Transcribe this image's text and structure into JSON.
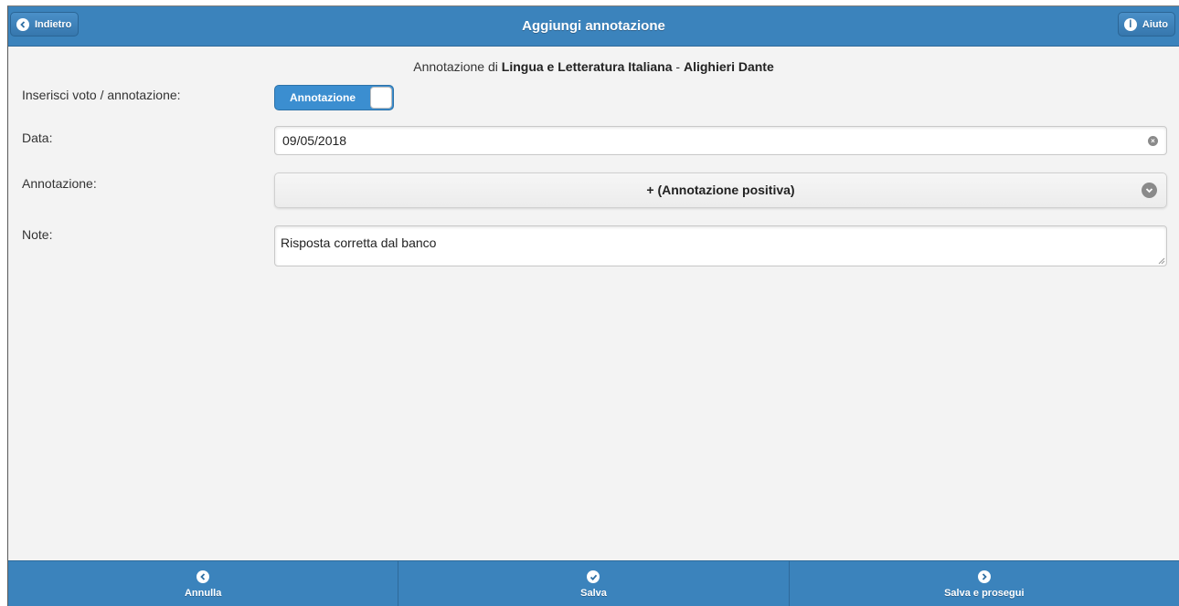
{
  "header": {
    "title": "Aggiungi annotazione",
    "back_label": "Indietro",
    "help_label": "Aiuto"
  },
  "subtitle": {
    "prefix": "Annotazione di ",
    "subject": "Lingua e Letteratura Italiana",
    "separator": " - ",
    "student": "Alighieri Dante"
  },
  "form": {
    "type_label": "Inserisci voto / annotazione:",
    "type_toggle_value": "Annotazione",
    "date_label": "Data:",
    "date_value": "09/05/2018",
    "annotation_label": "Annotazione:",
    "annotation_value": "+ (Annotazione positiva)",
    "note_label": "Note:",
    "note_value": "Risposta corretta dal banco"
  },
  "footer": {
    "cancel_label": "Annulla",
    "save_label": "Salva",
    "save_continue_label": "Salva e prosegui"
  },
  "colors": {
    "bar": "#3b83bc",
    "background": "#f3f3f3",
    "toggle": "#3b8ed0"
  }
}
